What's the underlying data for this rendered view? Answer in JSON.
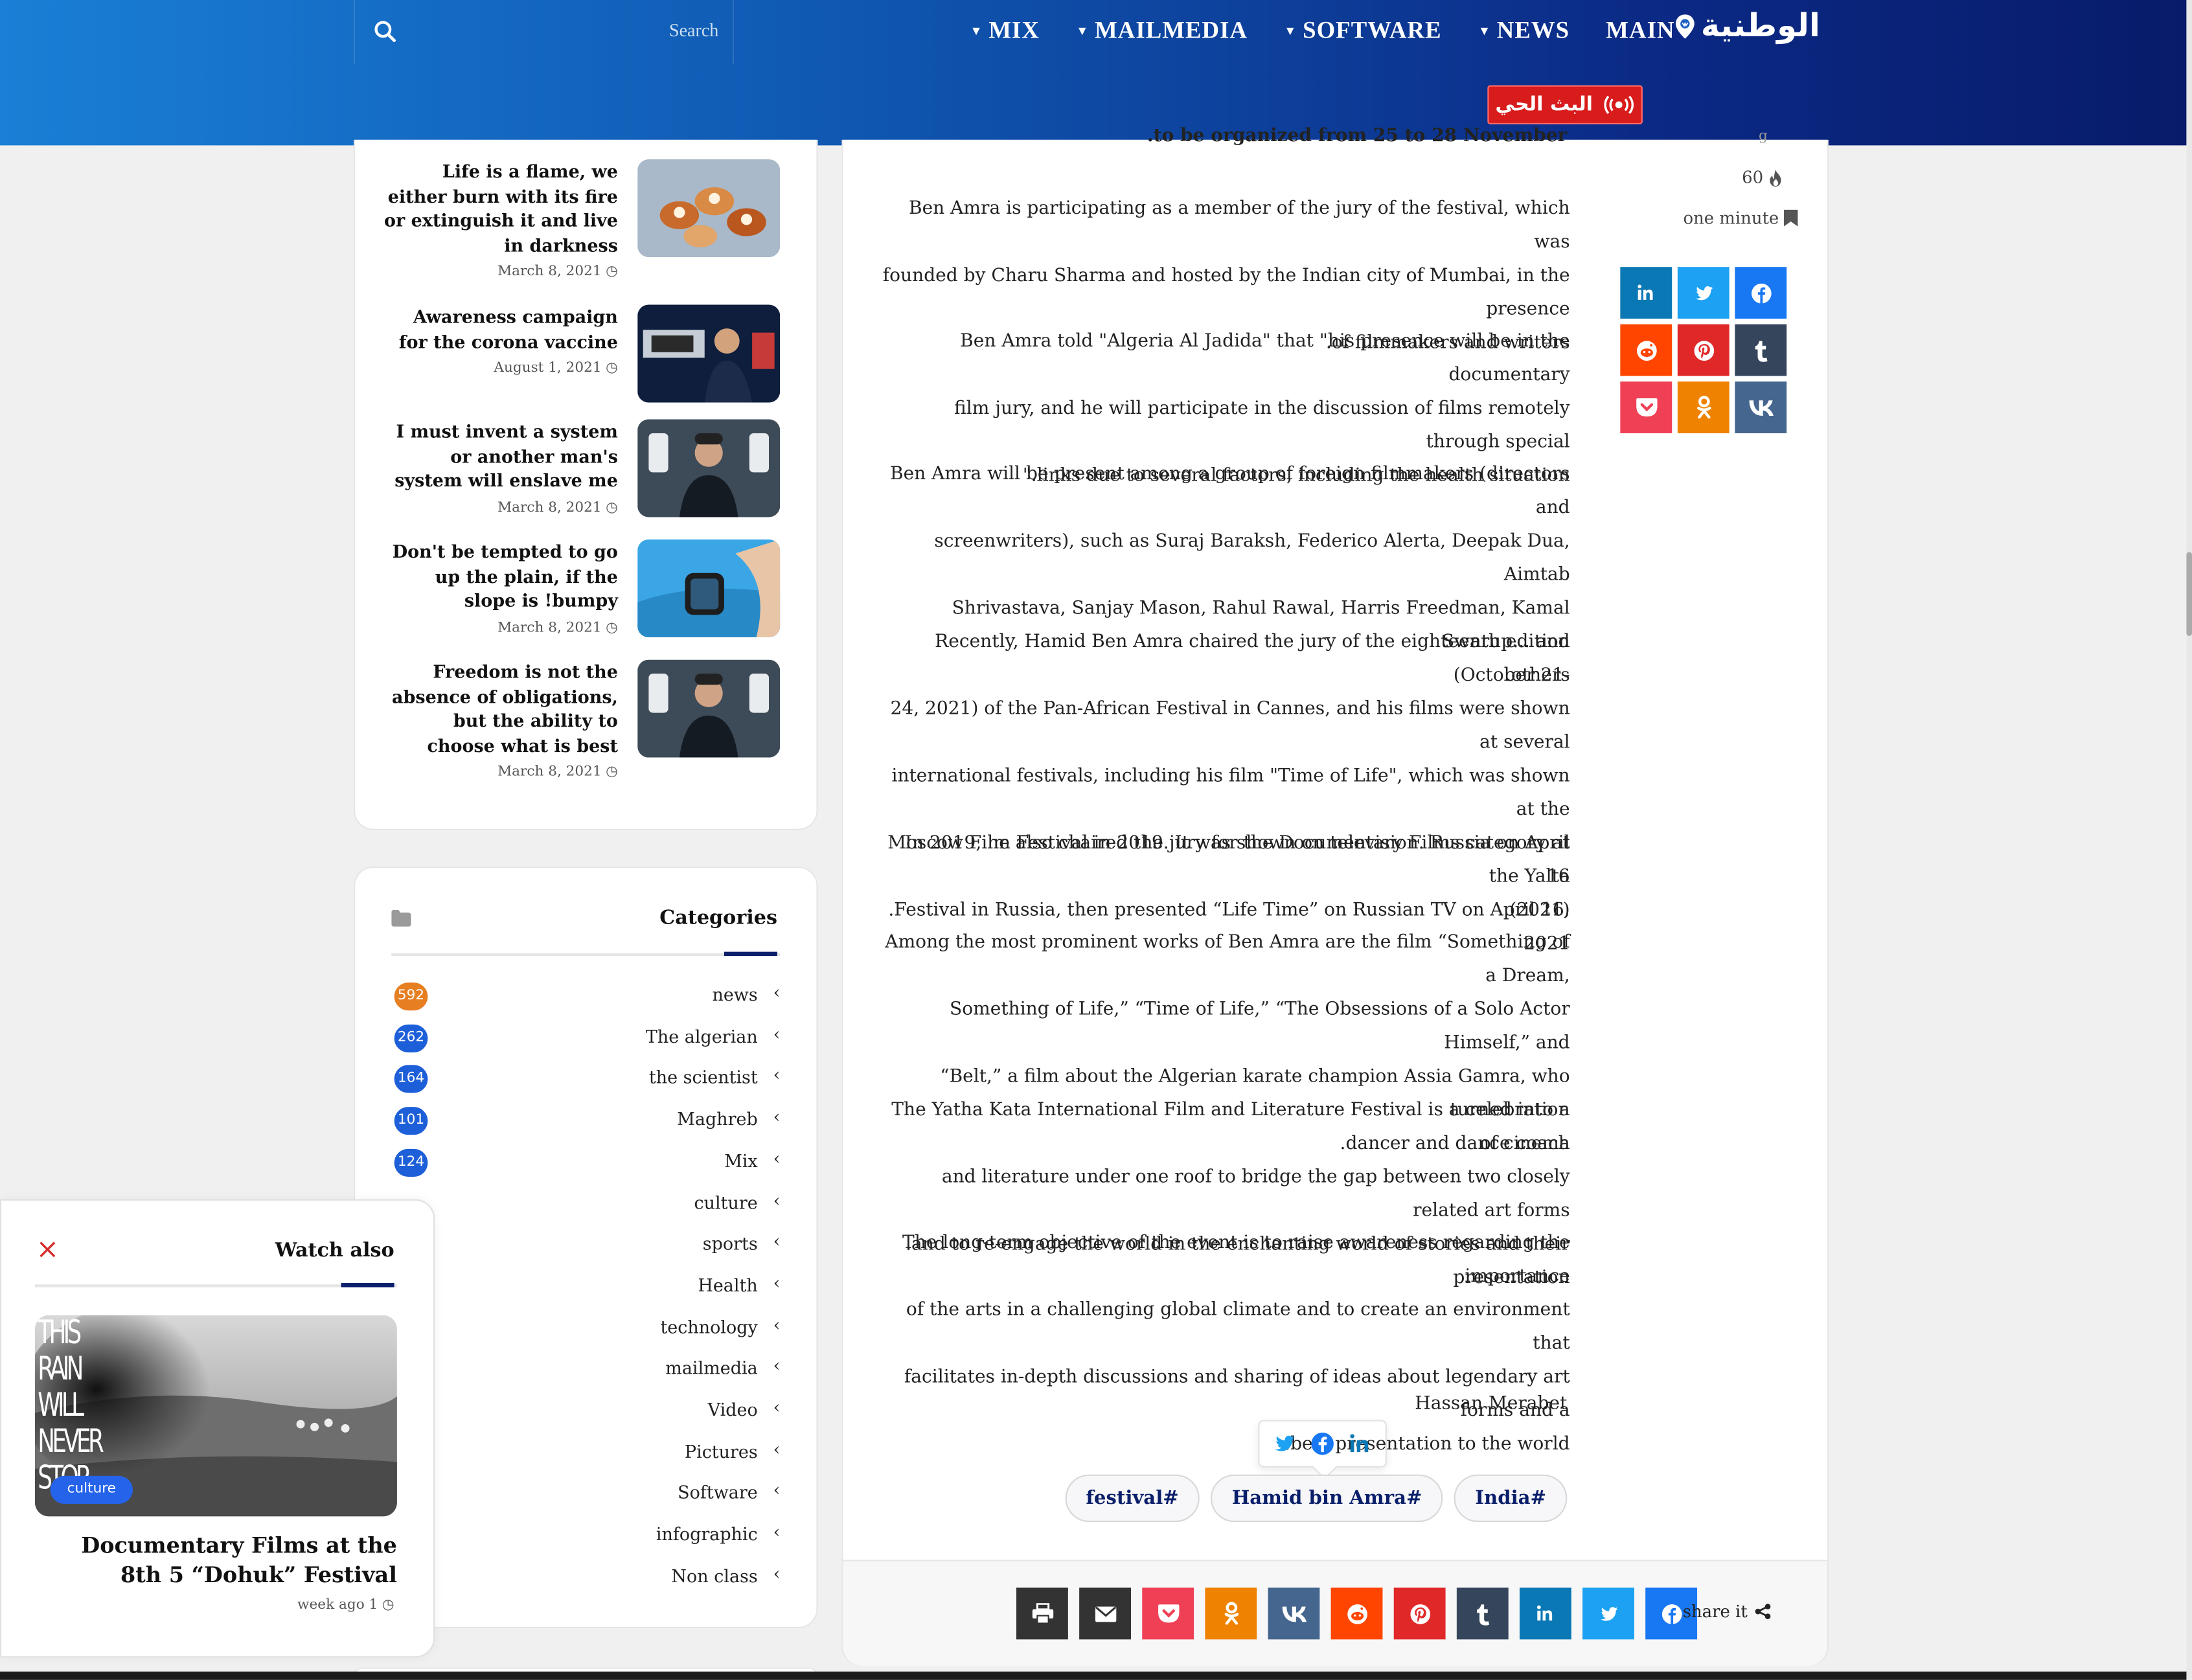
{
  "header": {
    "search_placeholder": "Search",
    "nav": [
      {
        "label": "MAIN",
        "has_caret": false
      },
      {
        "label": "NEWS",
        "has_caret": true
      },
      {
        "label": "SOFTWARE",
        "has_caret": true
      },
      {
        "label": "MAILMEDIA",
        "has_caret": true
      },
      {
        "label": "MIX",
        "has_caret": true
      }
    ],
    "logo_text": "الوطنية",
    "live_label": "البث الحي",
    "colors": {
      "start": "#1a7fd6",
      "end": "#081b6a",
      "live": "#d81b1b"
    }
  },
  "recent_posts": [
    {
      "title": "Life is a flame, we either burn with its fire or extinguish it and live in darkness",
      "date": "March 8, 2021",
      "thumb": "food-image"
    },
    {
      "title": "Awareness campaign for the corona vaccine",
      "date": "August 1, 2021",
      "thumb": "presenter-image"
    },
    {
      "title": "I must invent a system or another man's system will enslave me",
      "date": "March 8, 2021",
      "thumb": "phones-man-image"
    },
    {
      "title": "Don't be tempted to go up the plain, if the slope is !bumpy",
      "date": "March 8, 2021",
      "thumb": "smartwatch-image"
    },
    {
      "title": "Freedom is not the absence of obligations, but the ability to choose what is best",
      "date": "March 8, 2021",
      "thumb": "phones-man-image"
    }
  ],
  "categories": {
    "title": "Categories",
    "items": [
      {
        "name": "news",
        "count": "592",
        "color": "#e67e22"
      },
      {
        "name": "The algerian",
        "count": "262",
        "color": "#1d5fd8"
      },
      {
        "name": "the scientist",
        "count": "164",
        "color": "#1d5fd8"
      },
      {
        "name": "Maghreb",
        "count": "101",
        "color": "#1d5fd8"
      },
      {
        "name": "Mix",
        "count": "124",
        "color": "#1d5fd8"
      },
      {
        "name": "culture",
        "count": "",
        "color": "#1d5fd8"
      },
      {
        "name": "sports",
        "count": "",
        "color": "#1d5fd8"
      },
      {
        "name": "Health",
        "count": "",
        "color": "#1d5fd8"
      },
      {
        "name": "technology",
        "count": "",
        "color": "#1d5fd8"
      },
      {
        "name": "mailmedia",
        "count": "",
        "color": "#1d5fd8"
      },
      {
        "name": "Video",
        "count": "",
        "color": "#1d5fd8"
      },
      {
        "name": "Pictures",
        "count": "",
        "color": "#1d5fd8"
      },
      {
        "name": "Software",
        "count": "",
        "color": "#1d5fd8"
      },
      {
        "name": "infographic",
        "count": "",
        "color": "#1d5fd8"
      },
      {
        "name": "Non class",
        "count": "",
        "color": "#1d5fd8"
      }
    ]
  },
  "watch_also": {
    "title": "Watch also",
    "badge": "culture",
    "post_title": "Documentary Films at the 8th 5 “Dohuk” Festival",
    "date": "week ago 1",
    "poster_text": [
      "THIS",
      "RAIN",
      "WILL",
      "NEVER",
      "STOP"
    ]
  },
  "article": {
    "clipped_line": ".to be organized from 25 to 28 November",
    "paragraphs": [
      [
        "Ben Amra is participating as a member of the jury of the festival, which was",
        "founded by Charu Sharma and hosted by the Indian city of Mumbai, in the presence",
        ".of filmmakers and writers"
      ],
      [
        "Ben Amra told \"Algeria Al Jadida\" that \"his presence will be in the documentary",
        "film jury, and he will participate in the discussion of films remotely through special",
        "\".links due to several factors, including the health situation"
      ],
      [
        "Ben Amra will be present among a group of foreign filmmakers (directors and",
        "screenwriters), such as Suraj Baraksh, Federico Alerta, Deepak Dua, Aimtab",
        "Shrivastava, Sanjay Mason, Rahul Rawal, Harris Freedman, Kamal Swarup... and",
        ".others"
      ],
      [
        "Recently, Hamid Ben Amra chaired the jury of the eighteenth edition (October 21-",
        "24, 2021) of the Pan-African Festival in Cannes, and his films were shown at several",
        "international festivals, including his film \"Time of Life\", which was shown at the",
        "Moscow Film Festival in 2019. It was shown on television. Russia on April 16",
        ".(2021)"
      ],
      [
        "In 2019, he also chaired the jury for the Documentary Films category at the Yalta",
        ".Festival in Russia, then presented “Life Time” on Russian TV on April 16, 2021"
      ],
      [
        "Among the most prominent works of Ben Amra are the film “Something of a Dream,",
        "Something of Life,” “Time of Life,” “The Obsessions of a Solo Actor Himself,” and",
        "“Belt,” a film about the Algerian karate champion Assia Gamra, who turned into a",
        ".dancer and dance coach"
      ],
      [
        "The Yatha Kata International Film and Literature Festival is a celebration of cinema",
        "and literature under one roof to bridge the gap between two closely related art forms",
        ".and to re-engage the world in the enchanting world of stories and their presentation"
      ],
      [
        "The long-term objective of the event is to raise awareness regarding the importance",
        "of the arts in a challenging global climate and to create an environment that",
        "facilitates in-depth discussions and sharing of ideas about legendary art forms and a",
        ".best presentation to the world"
      ]
    ],
    "author": "Hassan Merabet",
    "tags": [
      "India#",
      "Hamid bin Amra#",
      "festival#"
    ],
    "share_label": "share it"
  },
  "meta": {
    "views": "60",
    "read_time": "one minute"
  },
  "share_buttons": [
    {
      "name": "facebook",
      "color": "#1877f2"
    },
    {
      "name": "twitter",
      "color": "#1da1f2"
    },
    {
      "name": "linkedin",
      "color": "#0a78b5"
    },
    {
      "name": "tumblr",
      "color": "#35465c"
    },
    {
      "name": "pinterest",
      "color": "#e12828"
    },
    {
      "name": "reddit",
      "color": "#ff4500"
    },
    {
      "name": "vk",
      "color": "#45668e"
    },
    {
      "name": "odnoklassniki",
      "color": "#ef8201"
    },
    {
      "name": "pocket",
      "color": "#ef4056"
    },
    {
      "name": "email",
      "color": "#333333"
    },
    {
      "name": "print",
      "color": "#333333"
    }
  ],
  "side_share": [
    {
      "name": "facebook",
      "color": "#1877f2"
    },
    {
      "name": "twitter",
      "color": "#1da1f2"
    },
    {
      "name": "linkedin",
      "color": "#0a78b5"
    },
    {
      "name": "tumblr",
      "color": "#35465c"
    },
    {
      "name": "pinterest",
      "color": "#e12828"
    },
    {
      "name": "reddit",
      "color": "#ff4500"
    },
    {
      "name": "vk",
      "color": "#45668e"
    },
    {
      "name": "odnoklassniki",
      "color": "#ef8201"
    },
    {
      "name": "pocket",
      "color": "#ef4056"
    }
  ]
}
